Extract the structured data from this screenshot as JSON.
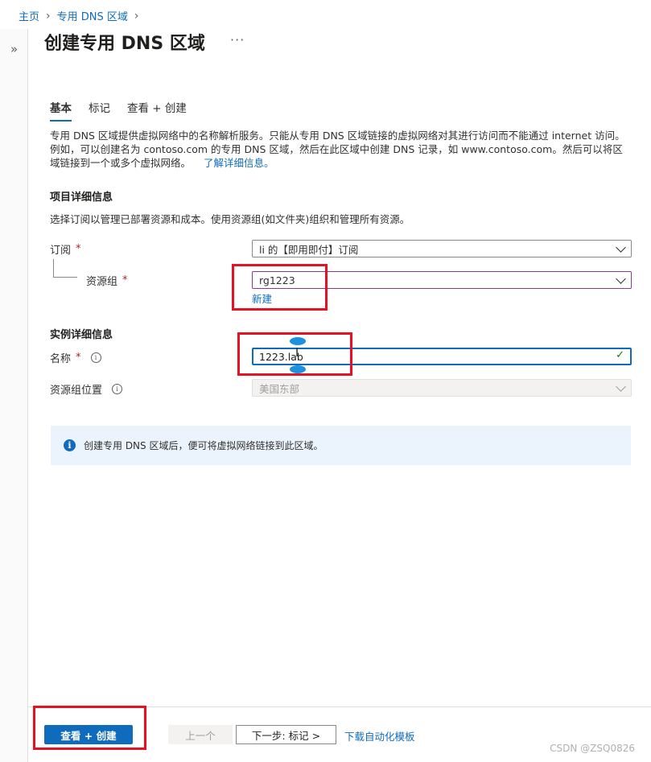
{
  "breadcrumb": {
    "home": "主页",
    "parent": "专用 DNS 区域"
  },
  "page": {
    "title": "创建专用 DNS 区域",
    "more": "···",
    "expand": "»"
  },
  "tabs": [
    {
      "label": "基本",
      "active": true
    },
    {
      "label": "标记",
      "active": false
    },
    {
      "label": "查看 + 创建",
      "active": false
    }
  ],
  "description": {
    "text": "专用 DNS 区域提供虚拟网络中的名称解析服务。只能从专用 DNS 区域链接的虚拟网络对其进行访问而不能通过 internet 访问。例如，可以创建名为 contoso.com 的专用 DNS 区域，然后在此区域中创建 DNS 记录，如 www.contoso.com。然后可以将区域链接到一个或多个虚拟网络。",
    "learn_more": "了解详细信息。"
  },
  "project": {
    "heading": "项目详细信息",
    "description": "选择订阅以管理已部署资源和成本。使用资源组(如文件夹)组织和管理所有资源。",
    "subscription_label": "订阅",
    "subscription_value": "li 的【即用即付】订阅",
    "resource_group_label": "资源组",
    "resource_group_value": "rg1223",
    "create_new": "新建"
  },
  "instance": {
    "heading": "实例详细信息",
    "name_label": "名称",
    "name_value": "1223.lab",
    "location_label": "资源组位置",
    "location_value": "美国东部"
  },
  "required_mark": "*",
  "info_glyph": "i",
  "info_message": "创建专用 DNS 区域后，便可将虚拟网络链接到此区域。",
  "footer": {
    "review_create": "查看 + 创建",
    "previous": "上一个",
    "next": "下一步: 标记 >",
    "download_template": "下载自动化模板"
  },
  "watermark": "CSDN @ZSQ0826",
  "colors": {
    "accent": "#0f6cbd",
    "annotation_red": "#e81123",
    "required": "#a4262c",
    "valid": "#107c10"
  }
}
